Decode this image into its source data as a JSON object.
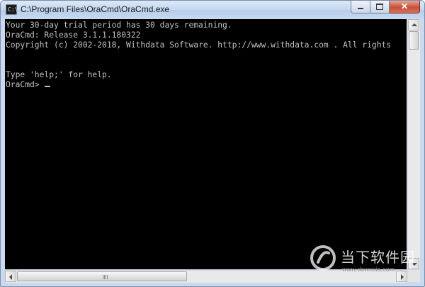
{
  "window": {
    "title": "C:\\Program Files\\OraCmd\\OraCmd.exe",
    "icon_text": "C:\\",
    "close_glyph": "✕"
  },
  "console": {
    "lines": [
      "Your 30-day trial period has 30 days remaining.",
      "OraCmd: Release 3.1.1.180322",
      "Copyright (c) 2002-2018, Withdata Software. http://www.withdata.com . All rights",
      "",
      "",
      "Type 'help;' for help.",
      "OraCmd> "
    ],
    "text_color": "#c0c0c0",
    "background_color": "#000000"
  },
  "watermark": {
    "main_text": "当下软件园",
    "url_text": "www.downxia.com"
  },
  "icons": {
    "minimize": "minimize-icon",
    "maximize": "maximize-icon",
    "close": "close-icon",
    "scroll_up": "arrow-up-icon",
    "scroll_down": "arrow-down-icon",
    "scroll_left": "arrow-left-icon",
    "scroll_right": "arrow-right-icon"
  }
}
